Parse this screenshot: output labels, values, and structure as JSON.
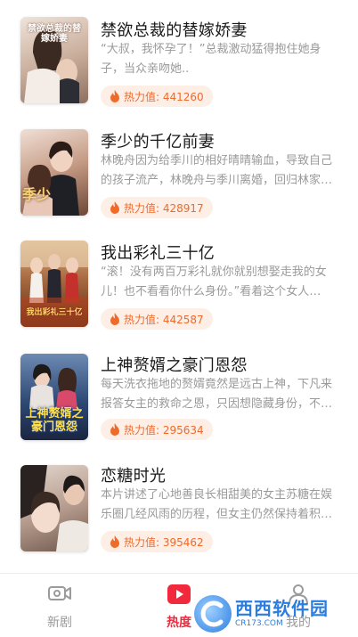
{
  "dramas": [
    {
      "title": "禁欲总裁的替嫁娇妻",
      "description": "“大叔，我怀孕了！”总裁激动猛得抱住她身子，当众亲吻她..",
      "heat_label": "热力值: 441260",
      "cover_text": "禁欲总裁的替嫁娇妻",
      "cover_colors": [
        "#e9d9cf",
        "#b89a86"
      ]
    },
    {
      "title": "季少的千亿前妻",
      "description": "林晚舟因为给季川的相好晴晴输血，导致自己的孩子流产，林晚舟与季川离婚，回归林家…",
      "heat_label": "热力值: 428917",
      "cover_text": "季少",
      "cover_colors": [
        "#e8cfc3",
        "#8a5e4a"
      ]
    },
    {
      "title": "我出彩礼三十亿",
      "description": "“滚！没有两百万彩礼就你就别想娶走我的女儿！也不看看你什么身份。”看着这个女人…",
      "heat_label": "热力值: 442587",
      "cover_text": "我出彩礼三十亿",
      "cover_colors": [
        "#c9a27a",
        "#6b3b23"
      ]
    },
    {
      "title": "上神赘婿之豪门恩怨",
      "description": "每天洗衣拖地的赘婿竟然是远古上神，下凡来报答女主的救命之恩，只因想隐藏身份，不…",
      "heat_label": "热力值: 295634",
      "cover_text": "上神赘婿之豪门恩怨",
      "cover_colors": [
        "#3a5a8a",
        "#1b2a48"
      ]
    },
    {
      "title": "恋糖时光",
      "description": "本片讲述了心地善良长相甜美的女主苏糖在娱乐圈几经风雨的历程，但女主仍然保持着积…",
      "heat_label": "热力值: 395462",
      "cover_text": "",
      "cover_colors": [
        "#d8c8bf",
        "#7a6458"
      ]
    }
  ],
  "tabs": [
    {
      "label": "新剧",
      "icon": "video-camera-icon",
      "active": false
    },
    {
      "label": "热度",
      "icon": "play-icon",
      "active": true
    },
    {
      "label": "我的",
      "icon": "person-icon",
      "active": false
    }
  ],
  "watermark": {
    "main": "西西软件园",
    "sub": "CR173.COM"
  },
  "colors": {
    "accent": "#f2293d",
    "heat_text": "#f06a2a",
    "heat_bg": "#fdeee6"
  }
}
